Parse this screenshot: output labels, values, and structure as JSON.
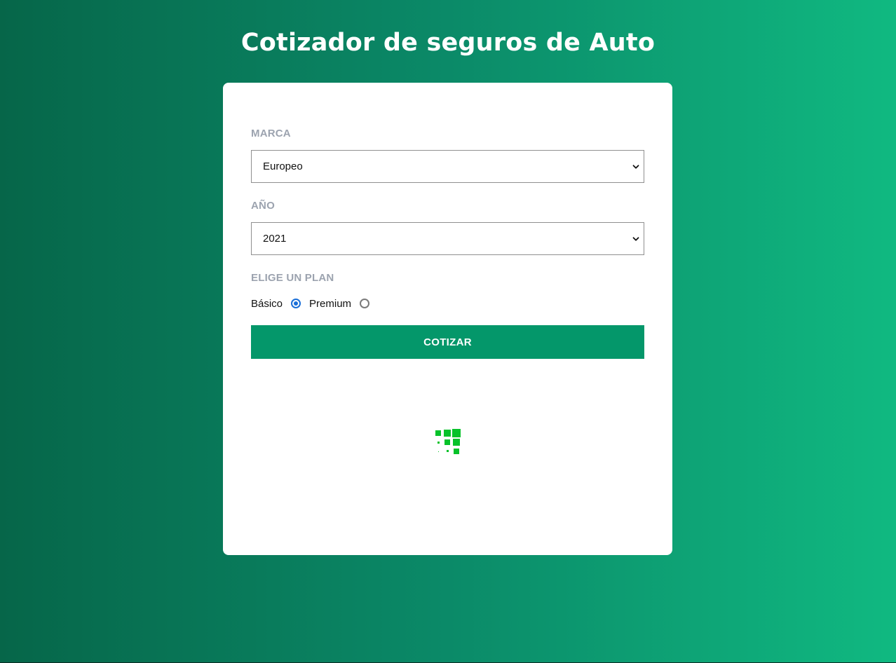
{
  "page": {
    "title": "Cotizador de seguros de Auto"
  },
  "form": {
    "marca": {
      "label": "MARCA",
      "selected": "Europeo",
      "icon": "chevron-down-icon"
    },
    "anio": {
      "label": "AÑO",
      "selected": "2021",
      "icon": "chevron-down-icon"
    },
    "plan": {
      "label": "ELIGE UN PLAN",
      "options": [
        {
          "label": "Básico",
          "checked": true
        },
        {
          "label": "Premium",
          "checked": false
        }
      ]
    },
    "submit_label": "COTIZAR"
  },
  "loader": {
    "icon": "loading-spinner-icon",
    "color": "#06c22a"
  },
  "colors": {
    "gradient_start": "#066649",
    "gradient_end": "#10b981",
    "button": "#04976a",
    "radio_accent": "#1a6fd8",
    "label": "#9ca3af"
  }
}
